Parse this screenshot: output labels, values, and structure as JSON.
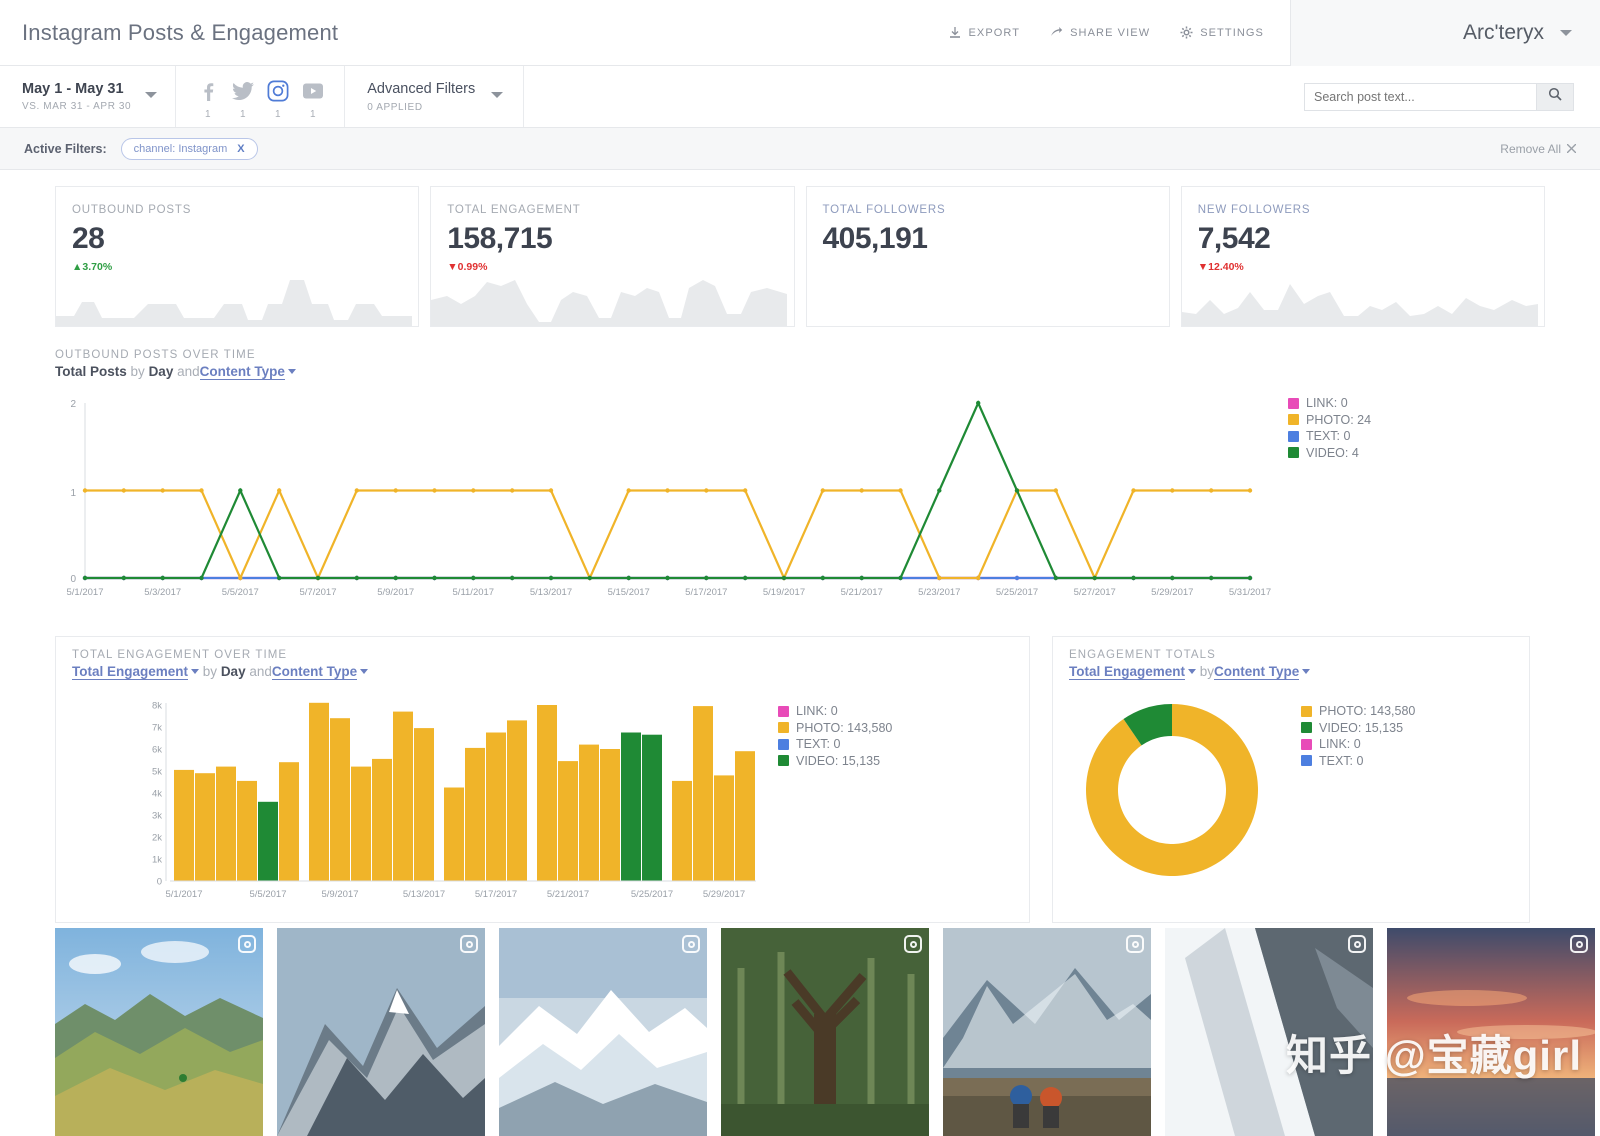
{
  "header": {
    "title": "Instagram Posts & Engagement",
    "actions": [
      {
        "label": "EXPORT",
        "icon": "download-icon"
      },
      {
        "label": "SHARE VIEW",
        "icon": "share-icon"
      },
      {
        "label": "SETTINGS",
        "icon": "gear-icon"
      }
    ],
    "account": "Arc'teryx"
  },
  "filters": {
    "date_range": {
      "main": "May 1 - May 31",
      "sub": "VS. MAR 31 - APR 30"
    },
    "channels": [
      {
        "name": "facebook",
        "count": "1",
        "selected": false
      },
      {
        "name": "twitter",
        "count": "1",
        "selected": false
      },
      {
        "name": "instagram",
        "count": "1",
        "selected": true
      },
      {
        "name": "youtube",
        "count": "1",
        "selected": false
      }
    ],
    "advanced": {
      "main": "Advanced Filters",
      "sub": "0 APPLIED"
    },
    "search": {
      "placeholder": "Search post text...",
      "value": ""
    },
    "active_label": "Active Filters:",
    "chips": [
      {
        "text": "channel: Instagram",
        "close": "X"
      }
    ],
    "remove_all": "Remove All"
  },
  "kpis": [
    {
      "label": "OUTBOUND POSTS",
      "value": "28",
      "delta": "3.70%",
      "dir": "up",
      "label_color": "grey",
      "spark": true
    },
    {
      "label": "TOTAL ENGAGEMENT",
      "value": "158,715",
      "delta": "0.99%",
      "dir": "down",
      "label_color": "grey",
      "spark": true
    },
    {
      "label": "TOTAL FOLLOWERS",
      "value": "405,191",
      "delta": "",
      "dir": "",
      "label_color": "blue",
      "spark": false
    },
    {
      "label": "NEW FOLLOWERS",
      "value": "7,542",
      "delta": "12.40%",
      "dir": "down",
      "label_color": "blue",
      "spark": true
    }
  ],
  "posts_over_time": {
    "title": "OUTBOUND POSTS OVER TIME",
    "sub_metric": "Total Posts",
    "sub_by": "by",
    "sub_dim": "Day",
    "sub_and": "and",
    "sub_dim2": "Content Type"
  },
  "engagement_over_time": {
    "title": "TOTAL ENGAGEMENT OVER TIME",
    "sub_metric": "Total Engagement",
    "sub_by": "by",
    "sub_dim": "Day",
    "sub_and": "and",
    "sub_dim2": "Content Type"
  },
  "engagement_totals": {
    "title": "ENGAGEMENT TOTALS",
    "sub_metric": "Total Engagement",
    "sub_by": "by",
    "sub_dim2": "Content Type"
  },
  "colors": {
    "link": "#e84bb8",
    "photo": "#f0b429",
    "text": "#4d7fe0",
    "video": "#1f8a35",
    "accent_blue": "#6b7fc0",
    "up": "#2f9e44",
    "down": "#e03131"
  },
  "chart_data": [
    {
      "id": "outbound-posts-over-time",
      "type": "line",
      "title": "OUTBOUND POSTS OVER TIME",
      "xlabel": "",
      "ylabel": "",
      "ylim": [
        0,
        2
      ],
      "yticks": [
        "0",
        "1",
        "2"
      ],
      "grid": false,
      "legend_position": "right",
      "x": [
        "5/1/2017",
        "5/2/2017",
        "5/3/2017",
        "5/4/2017",
        "5/5/2017",
        "5/6/2017",
        "5/7/2017",
        "5/8/2017",
        "5/9/2017",
        "5/10/2017",
        "5/11/2017",
        "5/12/2017",
        "5/13/2017",
        "5/14/2017",
        "5/15/2017",
        "5/16/2017",
        "5/17/2017",
        "5/18/2017",
        "5/19/2017",
        "5/20/2017",
        "5/21/2017",
        "5/22/2017",
        "5/23/2017",
        "5/24/2017",
        "5/25/2017",
        "5/26/2017",
        "5/27/2017",
        "5/28/2017",
        "5/29/2017",
        "5/30/2017",
        "5/31/2017"
      ],
      "tick_labels": [
        "5/1/2017",
        "5/3/2017",
        "5/5/2017",
        "5/7/2017",
        "5/9/2017",
        "5/11/2017",
        "5/13/2017",
        "5/15/2017",
        "5/17/2017",
        "5/19/2017",
        "5/21/2017",
        "5/23/2017",
        "5/25/2017",
        "5/27/2017",
        "5/29/2017",
        "5/31/2017"
      ],
      "series": [
        {
          "name": "LINK",
          "total": 0,
          "color": "#e84bb8",
          "values": [
            0,
            0,
            0,
            0,
            0,
            0,
            0,
            0,
            0,
            0,
            0,
            0,
            0,
            0,
            0,
            0,
            0,
            0,
            0,
            0,
            0,
            0,
            0,
            0,
            0,
            0,
            0,
            0,
            0,
            0,
            0
          ]
        },
        {
          "name": "PHOTO",
          "total": 24,
          "color": "#f0b429",
          "values": [
            1,
            1,
            1,
            1,
            0,
            1,
            0,
            1,
            1,
            1,
            1,
            1,
            1,
            0,
            1,
            1,
            1,
            1,
            0,
            1,
            1,
            1,
            0,
            0,
            1,
            1,
            0,
            1,
            1,
            1,
            1
          ]
        },
        {
          "name": "TEXT",
          "total": 0,
          "color": "#4d7fe0",
          "values": [
            0,
            0,
            0,
            0,
            0,
            0,
            0,
            0,
            0,
            0,
            0,
            0,
            0,
            0,
            0,
            0,
            0,
            0,
            0,
            0,
            0,
            0,
            0,
            0,
            0,
            0,
            0,
            0,
            0,
            0,
            0
          ]
        },
        {
          "name": "VIDEO",
          "total": 4,
          "color": "#1f8a35",
          "values": [
            0,
            0,
            0,
            0,
            1,
            0,
            0,
            0,
            0,
            0,
            0,
            0,
            0,
            0,
            0,
            0,
            0,
            0,
            0,
            0,
            0,
            0,
            1,
            2,
            1,
            0,
            0,
            0,
            0,
            0,
            0
          ]
        }
      ],
      "legend": [
        "LINK: 0",
        "PHOTO: 24",
        "TEXT: 0",
        "VIDEO: 4"
      ]
    },
    {
      "id": "total-engagement-over-time",
      "type": "bar",
      "title": "TOTAL ENGAGEMENT OVER TIME",
      "ylim": [
        0,
        8000
      ],
      "yticks": [
        "0",
        "1k",
        "2k",
        "3k",
        "4k",
        "5k",
        "6k",
        "7k",
        "8k"
      ],
      "tick_labels": [
        "5/1/2017",
        "5/5/2017",
        "5/9/2017",
        "5/13/2017",
        "5/17/2017",
        "5/21/2017",
        "5/25/2017",
        "5/29/2017"
      ],
      "categories": [
        "5/1/2017",
        "5/2/2017",
        "5/3/2017",
        "5/4/2017",
        "5/5/2017",
        "5/6/2017",
        "5/8/2017",
        "5/9/2017",
        "5/10/2017",
        "5/11/2017",
        "5/12/2017",
        "5/13/2017",
        "5/15/2017",
        "5/16/2017",
        "5/17/2017",
        "5/18/2017",
        "5/20/2017",
        "5/21/2017",
        "5/22/2017",
        "5/23/2017",
        "5/24/2017",
        "5/25/2017",
        "5/26/2017",
        "5/28/2017",
        "5/29/2017",
        "5/30/2017"
      ],
      "values": [
        5050,
        4900,
        5200,
        4550,
        3600,
        5400,
        8100,
        7400,
        5200,
        5550,
        7700,
        6950,
        4250,
        6050,
        6750,
        7300,
        8000,
        5450,
        6200,
        6000,
        6750,
        6650,
        4550,
        7950,
        4800,
        5900
      ],
      "bar_colors": [
        "photo",
        "photo",
        "photo",
        "photo",
        "video",
        "photo",
        "photo",
        "photo",
        "photo",
        "photo",
        "photo",
        "photo",
        "photo",
        "photo",
        "photo",
        "photo",
        "photo",
        "photo",
        "photo",
        "photo",
        "video",
        "video",
        "photo",
        "photo",
        "photo",
        "photo"
      ],
      "legend": [
        "LINK: 0",
        "PHOTO: 143,580",
        "TEXT: 0",
        "VIDEO: 15,135"
      ],
      "legend_values": {
        "LINK": 0,
        "PHOTO": 143580,
        "TEXT": 0,
        "VIDEO": 15135
      }
    },
    {
      "id": "engagement-totals",
      "type": "pie",
      "title": "ENGAGEMENT TOTALS",
      "labels": [
        "PHOTO",
        "VIDEO",
        "LINK",
        "TEXT"
      ],
      "values": [
        143580,
        15135,
        0,
        0
      ],
      "colors": [
        "#f0b429",
        "#1f8a35",
        "#e84bb8",
        "#4d7fe0"
      ],
      "legend": [
        "PHOTO: 143,580",
        "VIDEO: 15,135",
        "LINK: 0",
        "TEXT: 0"
      ],
      "legend_position": "right",
      "donut": true
    }
  ],
  "photos": [
    {
      "alt": "mountain-ridge-green-valley",
      "badge": "instagram-icon"
    },
    {
      "alt": "snowy-mountain-peak",
      "badge": "instagram-icon"
    },
    {
      "alt": "snow-covered-range",
      "badge": "instagram-icon"
    },
    {
      "alt": "forest-tall-tree",
      "badge": "instagram-icon"
    },
    {
      "alt": "climbers-on-rock",
      "badge": "instagram-icon"
    },
    {
      "alt": "snowy-cliff-face",
      "badge": "instagram-icon"
    },
    {
      "alt": "sunset-sky",
      "badge": "instagram-icon"
    }
  ],
  "watermark": "知乎 @宝藏girl"
}
